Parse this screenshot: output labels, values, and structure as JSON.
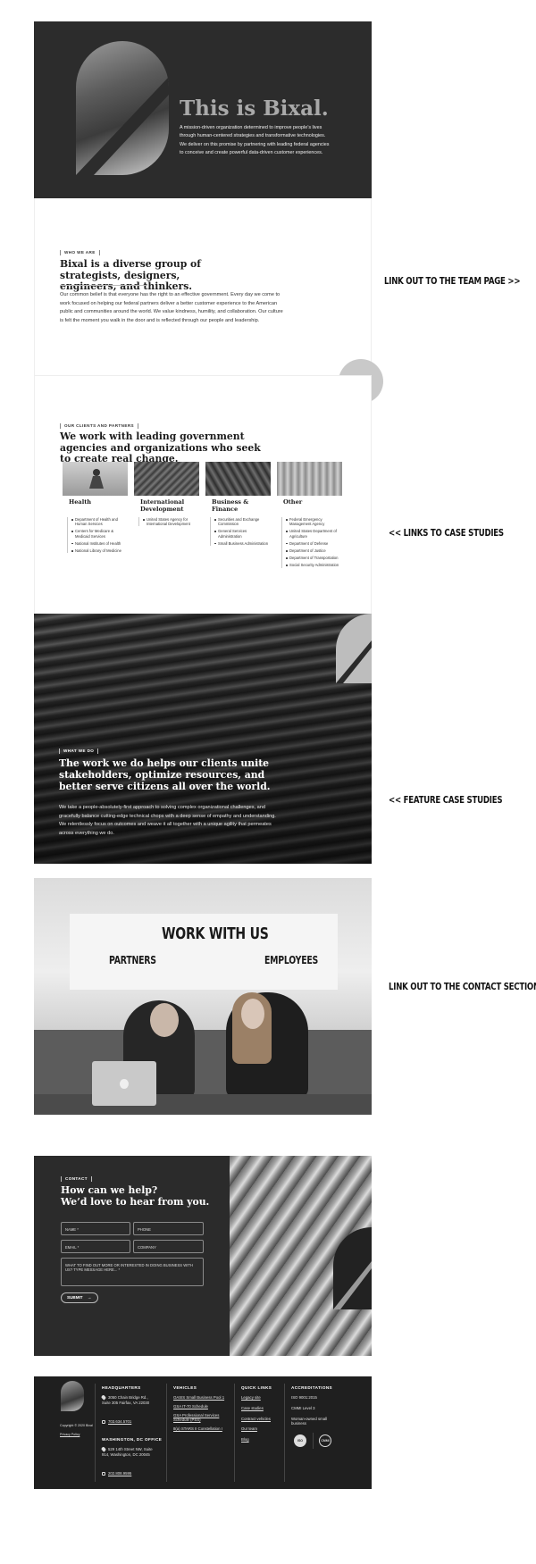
{
  "hero": {
    "title": "This is Bixal.",
    "description": "A mission-driven organization determined to improve people’s lives through human-centered strategies and transformative technologies. We deliver on this promise by partnering with leading federal agencies to conceive and create powerful data-driven customer experiences."
  },
  "who": {
    "eyebrow": "WHO WE ARE",
    "heading": "Bixal is a diverse group of strategists, designers, engineers, and thinkers.",
    "body": "Our common belief is that everyone has the right to an effective government. Every day we come to work focused on helping our federal partners deliver a better customer experience to the American public and communities around the world. We value kindness, humility, and collaboration. Our culture is felt the moment you walk in the door and is reflected through our people and leadership."
  },
  "clients": {
    "eyebrow": "OUR CLIENTS AND PARTNERS",
    "heading": "We work with leading government agencies and organizations who seek to create real change.",
    "sectors": [
      {
        "name": "Health",
        "items": [
          "Department of Health and Human Services",
          "Centers for Medicare & Medicaid Services",
          "National Institutes of Health",
          "National Library of Medicine"
        ]
      },
      {
        "name": "International Development",
        "items": [
          "United States Agency for International Development"
        ]
      },
      {
        "name": "Business & Finance",
        "items": [
          "Securities and Exchange Commission",
          "General Services Administration",
          "Small Business Administration"
        ]
      },
      {
        "name": "Other",
        "items": [
          "Federal Emergency Management Agency",
          "United States Department of Agriculture",
          "Department of Defense",
          "Department of Justice",
          "Department of Transportation",
          "Social Security Administration"
        ]
      }
    ]
  },
  "what": {
    "eyebrow": "WHAT WE DO",
    "heading": "The work we do helps our clients unite stakeholders, optimize resources, and better serve citizens all over the world.",
    "body": "We take a people-absolutely-first approach to solving complex organizational challenges, and gracefully balance cutting-edge technical chops with a deep sense of empathy and understanding. We relentlessly focus on outcomes and weave it all together with a unique agility that permeates across everything we do."
  },
  "work": {
    "heading": "WORK WITH US",
    "partners": "PARTNERS",
    "employees": "EMPLOYEES"
  },
  "contact": {
    "eyebrow": "CONTACT",
    "heading_line1": "How can we help?",
    "heading_line2": "We’d love to hear from you.",
    "name_placeholder": "NAME *",
    "phone_placeholder": "PHONE",
    "email_placeholder": "EMAIL *",
    "company_placeholder": "COMPANY",
    "message_placeholder": "WHAT TO FIND OUT MORE OR INTERESTED IN DOING BUSINESS WITH US? TYPE MESSAGE HERE... *",
    "submit_label": "SUBMIT"
  },
  "footer": {
    "copyright": "Copyright © 2020 Bixal",
    "privacy": "Privacy Policy",
    "hq_title": "HEADQUARTERS",
    "hq_address": "3050 Chain Bridge Rd., Suite 305 Fairfax, VA 22030",
    "hq_phone": "703.634.5701",
    "dc_title": "WASHINGTON, DC OFFICE",
    "dc_address": "529 14th Street NW, Suite 914, Washington, DC 20045",
    "dc_phone": "202.808.9595",
    "vehicles_title": "VEHICLES",
    "vehicles": [
      "OASIS Small Business Pool 1",
      "GSA IT-70 Schedule",
      "GSA Professional Services Schedule (PSS)",
      "8(a) STARS II Constellation I"
    ],
    "quick_title": "QUICK LINKS",
    "quick_links": [
      "Legacy site",
      "Case studies",
      "Contract vehicles",
      "Our team",
      "Blog"
    ],
    "accred_title": "ACCREDITATIONS",
    "accreditations": [
      "ISO 9001:2015",
      "CMMI Level 3",
      "Woman-owned small business"
    ],
    "badge_iso": "ISO",
    "badge_cmmi": "CMMI"
  },
  "annotations": {
    "team": "LINK OUT TO THE TEAM PAGE >>",
    "case_studies": "<< LINKS TO CASE STUDIES",
    "feature": "<< FEATURE CASE STUDIES",
    "contact": "LINK OUT TO THE CONTACT SECTIONS >>"
  }
}
